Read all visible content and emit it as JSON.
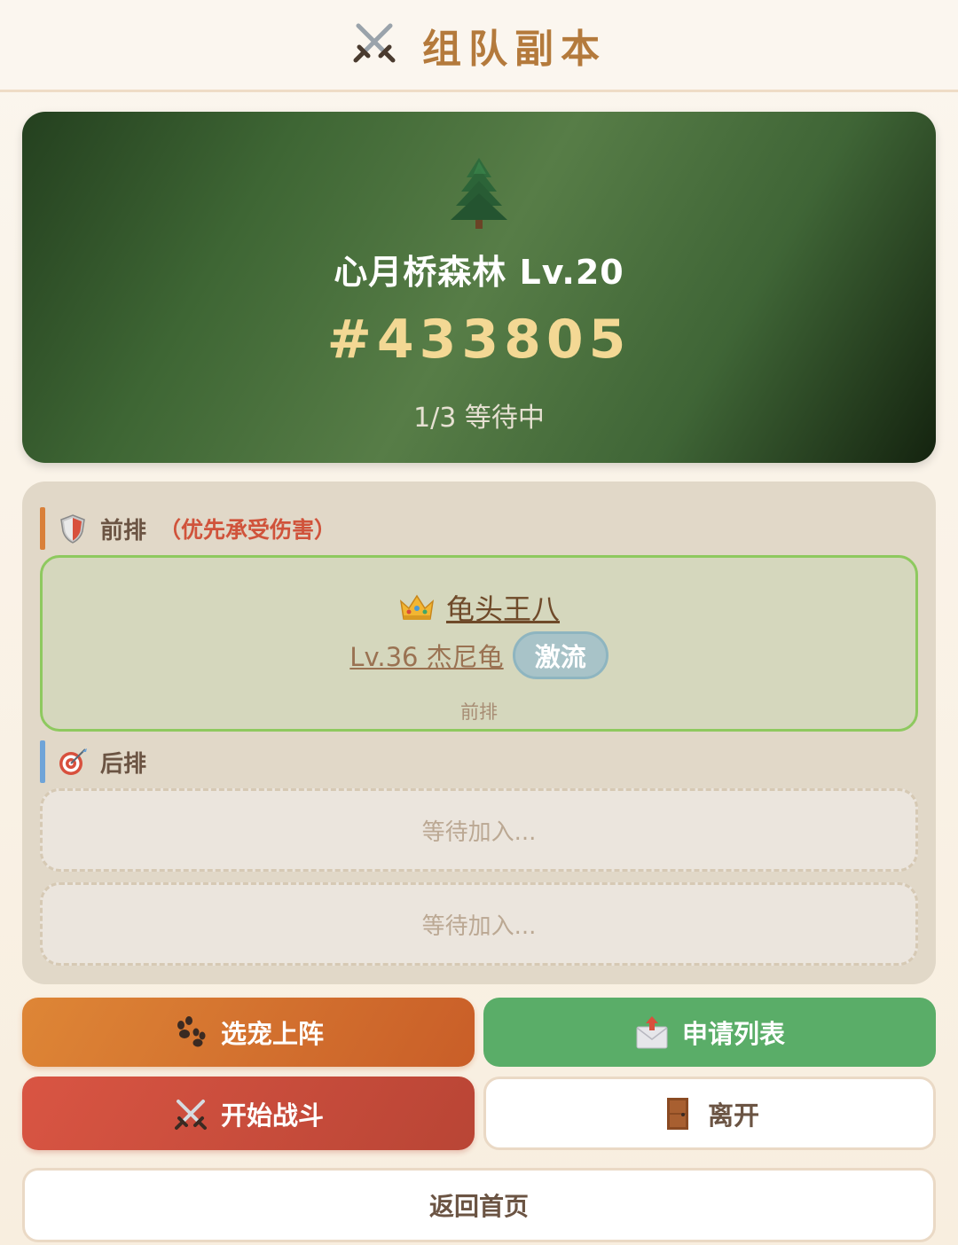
{
  "header": {
    "icon": "crossed-swords-icon",
    "title": "组队副本"
  },
  "dungeon": {
    "icon": "pine-tree-icon",
    "name": "心月桥森林 Lv.20",
    "room_code": "#433805",
    "status": "1/3 等待中"
  },
  "front_row": {
    "icon": "shield-icon",
    "label": "前排",
    "hint": "（优先承受伤害）",
    "member": {
      "icon": "crown-icon",
      "name": "龟头王八",
      "level_pet": "Lv.36 杰尼龟",
      "skill": "激流",
      "position": "前排"
    }
  },
  "back_row": {
    "icon": "target-icon",
    "label": "后排",
    "slots": [
      "等待加入...",
      "等待加入..."
    ]
  },
  "actions": {
    "pick_pet": {
      "icon": "paw-icon",
      "label": "选宠上阵"
    },
    "applications": {
      "icon": "envelope-icon",
      "label": "申请列表"
    },
    "start_battle": {
      "icon": "crossed-swords-icon",
      "label": "开始战斗"
    },
    "leave": {
      "icon": "door-icon",
      "label": "离开"
    },
    "home": {
      "label": "返回首页"
    }
  },
  "colors": {
    "accent": "#b47a3c",
    "card_green": "#3e6634",
    "code_gold": "#f3d894",
    "warning_red": "#d0533b",
    "orange": "#d97530",
    "green": "#5aad68",
    "red": "#cf4f3f"
  }
}
